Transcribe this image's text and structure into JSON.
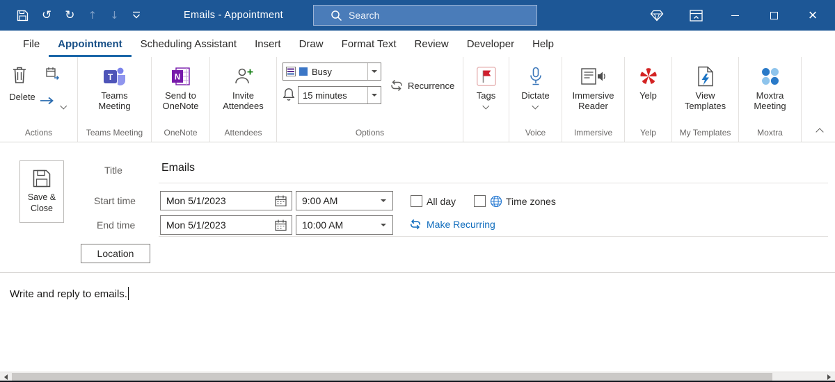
{
  "titlebar": {
    "title": "Emails - Appointment",
    "search_placeholder": "Search"
  },
  "menubar": {
    "items": [
      "File",
      "Appointment",
      "Scheduling Assistant",
      "Insert",
      "Draw",
      "Format Text",
      "Review",
      "Developer",
      "Help"
    ],
    "active_item": "Appointment"
  },
  "ribbon": {
    "delete": "Delete",
    "teams_meeting": "Teams Meeting",
    "send_to_onenote": "Send to OneNote",
    "invite_attendees": "Invite Attendees",
    "show_as_value": "Busy",
    "reminder_value": "15 minutes",
    "recurrence": "Recurrence",
    "tags": "Tags",
    "dictate": "Dictate",
    "immersive_reader": "Immersive Reader",
    "yelp": "Yelp",
    "view_templates": "View Templates",
    "moxtra_meeting": "Moxtra Meeting",
    "groups": {
      "actions": "Actions",
      "teams_meeting": "Teams Meeting",
      "onenote": "OneNote",
      "attendees": "Attendees",
      "options": "Options",
      "voice": "Voice",
      "immersive": "Immersive",
      "yelp": "Yelp",
      "my_templates": "My Templates",
      "moxtra": "Moxtra"
    }
  },
  "form": {
    "save_close": "Save & Close",
    "title_label": "Title",
    "title_value": "Emails",
    "start_label": "Start time",
    "end_label": "End time",
    "start_date": "Mon 5/1/2023",
    "start_time": "9:00 AM",
    "end_date": "Mon 5/1/2023",
    "end_time": "10:00 AM",
    "all_day_label": "All day",
    "time_zones_label": "Time zones",
    "make_recurring_label": "Make Recurring",
    "location_label": "Location"
  },
  "body": {
    "text": "Write and reply to emails."
  },
  "colors": {
    "titlebar_blue": "#1d5796",
    "accent_blue": "#0f6cbd",
    "active_tab_underline": "#1a66a8",
    "busy_swatch_blue": "#3b76c6",
    "flag_red": "#cf1f2e",
    "yelp_red": "#d32323",
    "teams_purple": "#4e54b8",
    "onenote_purple": "#7719aa",
    "link_blue": "#0f6cbd"
  },
  "icons": {
    "save-icon": "floppy-disk",
    "undo-icon": "circular-arrow-left",
    "redo-icon": "circular-arrow-right",
    "previous-item-icon": "up-arrow",
    "next-item-icon": "down-arrow",
    "customize-toolbar-icon": "overline-chevron-down",
    "search-icon": "magnifier",
    "gem-icon": "diamond-outline",
    "ribbon-display-options-icon": "panel-chevron-up",
    "minimize-icon": "horizontal-bar",
    "maximize-icon": "square-outline",
    "close-icon": "cross",
    "delete-icon": "trash-can",
    "forward-icon": "calendar-with-arrow",
    "teams-icon": "teams-logo",
    "onenote-icon": "onenote-logo",
    "invite-attendees-icon": "person-with-plus",
    "show-as-icon": "striped-status-square",
    "busy-color-swatch": "blue-square",
    "reminder-bell-icon": "bell",
    "recurrence-icon": "circular-arrows",
    "tags-flag-icon": "red-flag",
    "dictate-mic-icon": "microphone",
    "immersive-reader-icon": "document-with-speaker",
    "yelp-icon": "red-burst",
    "view-templates-icon": "document-with-lightning",
    "moxtra-icon": "four-blue-dots",
    "save-close-icon": "floppy-disk",
    "calendar-picker-icon": "calendar",
    "globe-icon": "globe",
    "make-recurring-icon": "circular-arrows-blue",
    "collapse-ribbon-icon": "chevron-up"
  }
}
